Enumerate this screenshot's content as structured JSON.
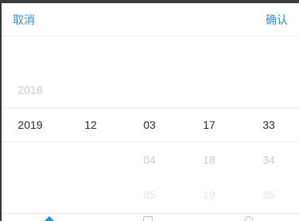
{
  "header": {
    "cancel_label": "取消",
    "confirm_label": "确认"
  },
  "picker": {
    "year": {
      "prev": "2018",
      "selected": "2019"
    },
    "month": {
      "selected": "12"
    },
    "day": {
      "selected": "03",
      "next1": "04",
      "next2": "05"
    },
    "hour": {
      "selected": "17",
      "next1": "18",
      "next2": "19"
    },
    "minute": {
      "selected": "33",
      "next1": "34",
      "next2": "35"
    }
  },
  "bottom_nav": {
    "icons": [
      "home-icon",
      "calendar-icon",
      "user-icon"
    ]
  },
  "colors": {
    "accent": "#2e8fd6",
    "selected_text": "#333333",
    "faded_text": "#cccccc",
    "very_faded_text": "#e6e6e6",
    "nav_active": "#1a98e0",
    "topbar": "#3b3b3b"
  }
}
